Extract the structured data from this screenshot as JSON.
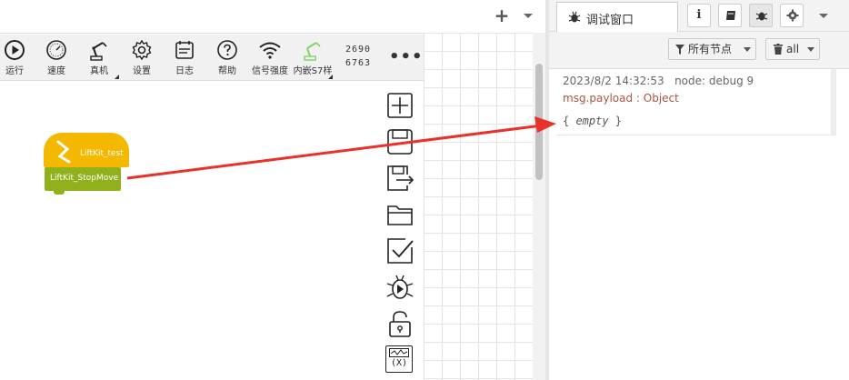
{
  "colors": {
    "hat_block": "#f5b800",
    "command_block": "#8fb21c",
    "arrow": "#e8312a",
    "topic_text": "#aa5540"
  },
  "toolbar": {
    "items": [
      {
        "label": "运行",
        "icon": "play-icon"
      },
      {
        "label": "速度",
        "icon": "speed-gauge-icon"
      },
      {
        "label": "真机",
        "icon": "robot-arm-icon"
      },
      {
        "label": "设置",
        "icon": "gear-icon"
      },
      {
        "label": "日志",
        "icon": "calendar-log-icon"
      },
      {
        "label": "帮助",
        "icon": "help-icon"
      },
      {
        "label": "信号强度",
        "icon": "wifi-signal-icon"
      },
      {
        "label": "内嵌S7样",
        "icon": "robot-arm-green-icon"
      }
    ],
    "coords": [
      "2690",
      "6763"
    ],
    "more_label": "•••"
  },
  "blocks": {
    "hat_label": "LiftKit_test",
    "command_label": "LiftKit_StopMove"
  },
  "side_icons": [
    "zoom-plus-icon",
    "save-icon",
    "save-as-icon",
    "open-folder-icon",
    "check-icon",
    "debug-run-icon",
    "unlock-icon",
    "variable-icon"
  ],
  "variable_icon_text": "(X)",
  "flow_header": {
    "add_label": "+"
  },
  "sidebar": {
    "tab_label": "调试窗口",
    "info_label": "i",
    "filter_label": "所有节点",
    "clear_label": "all"
  },
  "message": {
    "time": "2023/8/2 14:32:53",
    "node": "node: debug 9",
    "topic": "msg.payload : Object",
    "body_open": "{ ",
    "body_value": "empty",
    "body_close": " }"
  }
}
